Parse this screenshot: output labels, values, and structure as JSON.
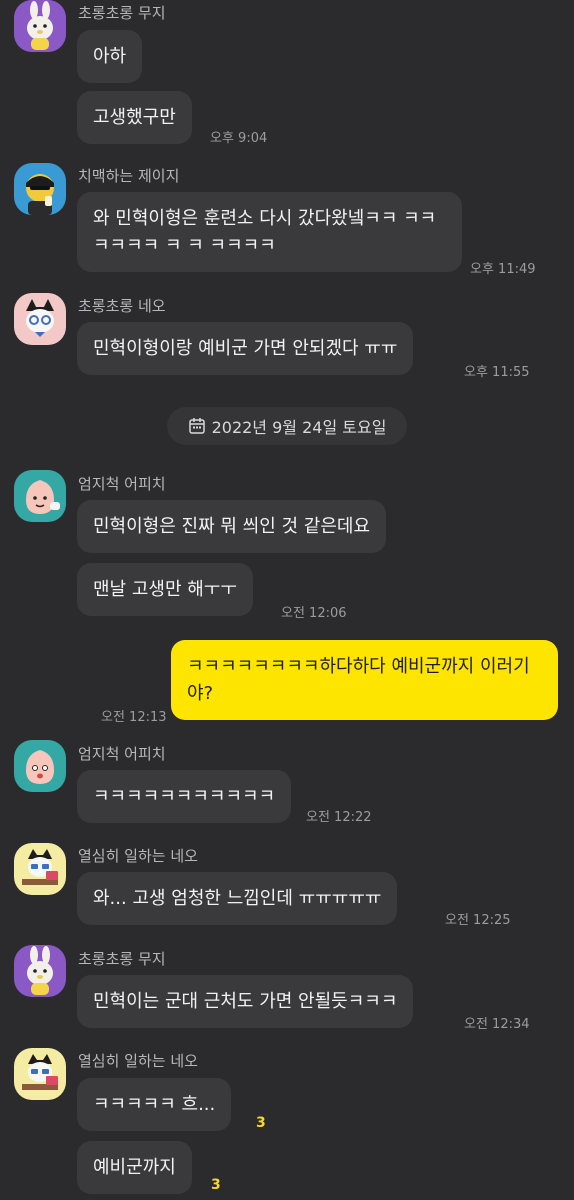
{
  "messages": [
    {
      "sender": "초롱초롱 무지",
      "avatar": "muzi-avatar",
      "lines": [
        "아하",
        "고생했구만"
      ],
      "time": "오후 9:04"
    },
    {
      "sender": "치맥하는 제이지",
      "avatar": "jayg-avatar",
      "lines": [
        "와 민혁이형은 훈련소 다시 갔다왔넼ㅋㅋ ㅋㅋ ㅋㅋㅋㅋ ㅋ ㅋ ㅋㅋㅋㅋ"
      ],
      "time": "오후 11:49"
    },
    {
      "sender": "초롱초롱 네오",
      "avatar": "neo-avatar",
      "lines": [
        "민혁이형이랑 예비군 가면 안되겠다 ㅠㅠ"
      ],
      "time": "오후 11:55"
    },
    {
      "sender": "엄지척 어피치",
      "avatar": "apeach-avatar",
      "lines": [
        "민혁이형은 진짜 뭐 씌인 것 같은데요",
        "맨날 고생만 해ㅜㅜ"
      ],
      "time": "오전 12:06"
    },
    {
      "sender": "",
      "mine": true,
      "lines": [
        "ㅋㅋㅋㅋㅋㅋㅋㅋ하다하다 예비군까지 이러기야?"
      ],
      "time": "오전 12:13"
    },
    {
      "sender": "엄지척 어피치",
      "avatar": "apeach-avatar",
      "lines": [
        "ㅋㅋㅋㅋㅋㅋㅋㅋㅋㅋㅋ"
      ],
      "time": "오전 12:22"
    },
    {
      "sender": "열심히 일하는 네오",
      "avatar": "working-neo-avatar",
      "lines": [
        "와... 고생 엄청한 느낌인데 ㅠㅠㅠㅠㅠ"
      ],
      "time": "오전 12:25"
    },
    {
      "sender": "초롱초롱 무지",
      "avatar": "muzi-avatar",
      "lines": [
        "민혁이는 군대 근처도 가면 안될듯ㅋㅋㅋ"
      ],
      "time": "오전 12:34"
    },
    {
      "sender": "열심히 일하는 네오",
      "avatar": "working-neo-avatar",
      "lines": [
        "ㅋㅋㅋㅋㅋ 흐...",
        "예비군까지"
      ],
      "unread": [
        "3",
        "3"
      ]
    }
  ],
  "date_divider": {
    "label": "2022년 9월 24일 토요일",
    "icon": "calendar-icon"
  },
  "colors": {
    "background": "#2b2b2d",
    "bubble_other": "#3a3a3d",
    "bubble_mine": "#fee500",
    "unread": "#f6d82f"
  }
}
